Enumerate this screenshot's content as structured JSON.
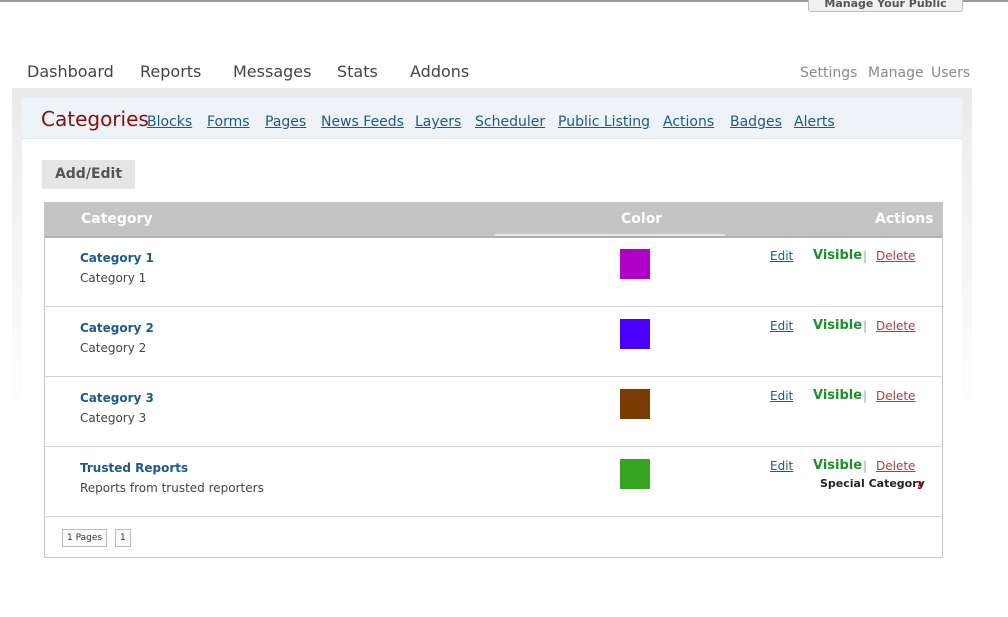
{
  "top_button": {
    "label": "Manage Your Public Listing"
  },
  "main_nav": [
    "Dashboard",
    "Reports",
    "Messages",
    "Stats",
    "Addons"
  ],
  "right_nav": [
    "Settings",
    "Manage",
    "Users"
  ],
  "subnav": {
    "title": "Categories",
    "links": [
      "Blocks",
      "Forms",
      "Pages",
      "News Feeds",
      "Layers",
      "Scheduler",
      "Public Listing",
      "Actions",
      "Badges",
      "Alerts"
    ]
  },
  "tab": {
    "label": "Add/Edit"
  },
  "table": {
    "headers": {
      "category": "Category",
      "color": "Color",
      "actions": "Actions"
    },
    "rows": [
      {
        "name": "Category 1",
        "desc": "Category 1",
        "color": "#b000c8",
        "edit": "Edit",
        "visible": "Visible",
        "pipe": "|",
        "delete": "Delete"
      },
      {
        "name": "Category 2",
        "desc": "Category 2",
        "color": "#4a00ff",
        "edit": "Edit",
        "visible": "Visible",
        "pipe": "|",
        "delete": "Delete"
      },
      {
        "name": "Category 3",
        "desc": "Category 3",
        "color": "#7a3b00",
        "edit": "Edit",
        "visible": "Visible",
        "pipe": "|",
        "delete": "Delete"
      },
      {
        "name": "Trusted Reports",
        "desc": "Reports from trusted reporters",
        "color": "#36a321",
        "edit": "Edit",
        "visible": "Visible",
        "pipe": "|",
        "delete": "Delete",
        "special": "Special Category",
        "help": "?"
      }
    ]
  },
  "pager": {
    "pages_label": "1 Pages",
    "current": "1"
  }
}
